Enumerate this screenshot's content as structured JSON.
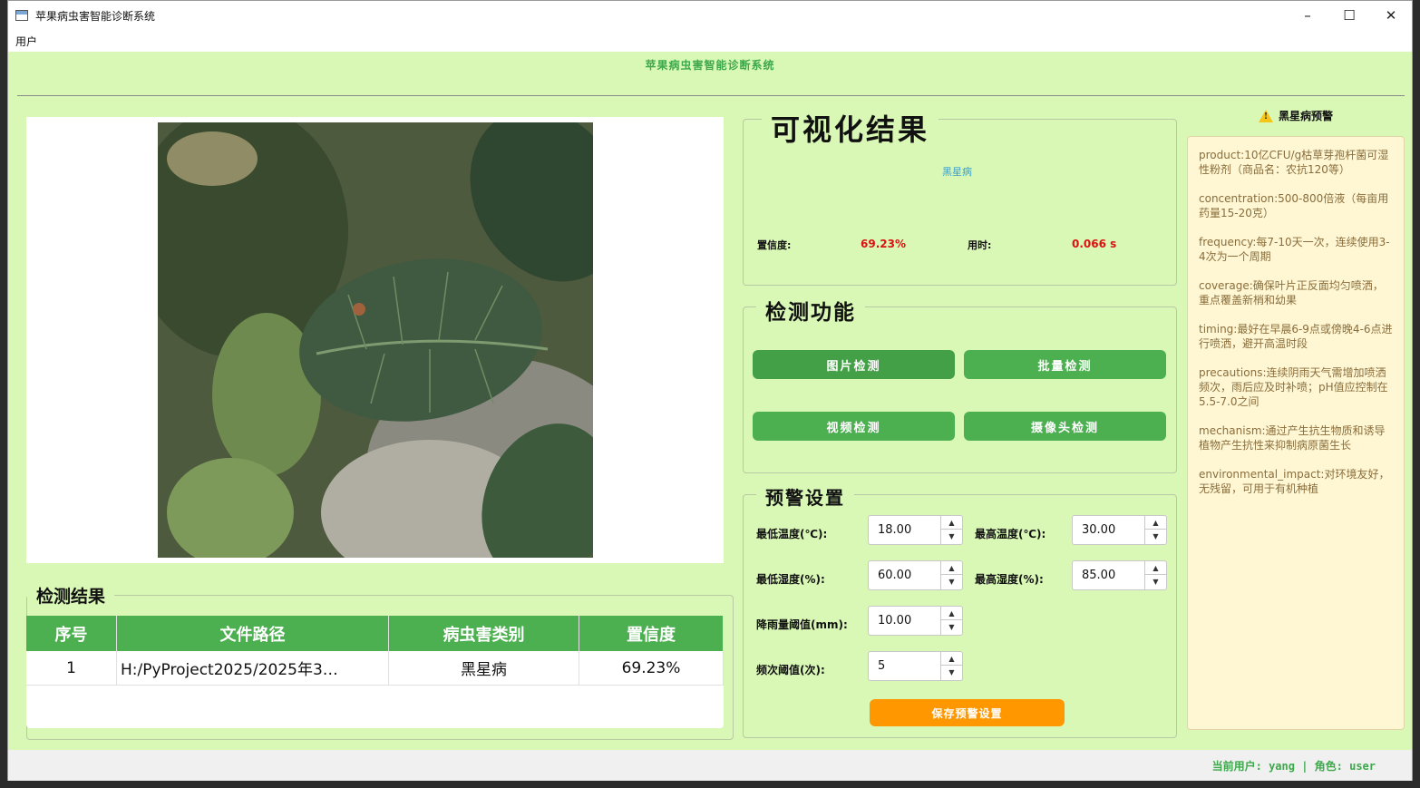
{
  "window": {
    "title": "苹果病虫害智能诊断系统",
    "minimize": "–",
    "maximize": "☐",
    "close": "✕"
  },
  "menu": {
    "user": "用户"
  },
  "header": {
    "title": "苹果病虫害智能诊断系统"
  },
  "results": {
    "group_title": "检测结果",
    "columns": [
      "序号",
      "文件路径",
      "病虫害类别",
      "置信度"
    ],
    "rows": [
      {
        "index": "1",
        "path": "H:/PyProject2025/2025年3…",
        "category": "黑星病",
        "confidence": "69.23%"
      }
    ]
  },
  "visual": {
    "group_title": "可视化结果",
    "class_name": "黑星病",
    "confidence_label": "置信度:",
    "confidence_value": "69.23%",
    "time_label": "用时:",
    "time_value": "0.066 s"
  },
  "detect": {
    "group_title": "检测功能",
    "image_btn": "图片检测",
    "batch_btn": "批量检测",
    "video_btn": "视频检测",
    "camera_btn": "摄像头检测"
  },
  "settings": {
    "group_title": "预警设置",
    "min_temp_label": "最低温度(℃):",
    "min_temp": "18.00",
    "max_temp_label": "最高温度(℃):",
    "max_temp": "30.00",
    "min_hum_label": "最低湿度(%):",
    "min_hum": "60.00",
    "max_hum_label": "最高湿度(%):",
    "max_hum": "85.00",
    "rain_label": "降雨量阈值(mm):",
    "rain": "10.00",
    "freq_label": "频次阈值(次):",
    "freq": "5",
    "save_btn": "保存预警设置"
  },
  "warning": {
    "title": "黑星病预警",
    "items": [
      "product:10亿CFU/g枯草芽孢杆菌可湿性粉剂（商品名：农抗120等）",
      "concentration:500-800倍液（每亩用药量15-20克）",
      "frequency:每7-10天一次，连续使用3-4次为一个周期",
      "coverage:确保叶片正反面均匀喷洒，重点覆盖新梢和幼果",
      "timing:最好在早晨6-9点或傍晚4-6点进行喷洒，避开高温时段",
      "precautions:连续阴雨天气需增加喷洒频次，雨后应及时补喷；pH值应控制在5.5-7.0之间",
      "mechanism:通过产生抗生物质和诱导植物产生抗性来抑制病原菌生长",
      "environmental_impact:对环境友好，无残留，可用于有机种植"
    ]
  },
  "status": {
    "text": "当前用户: yang | 角色: user"
  }
}
